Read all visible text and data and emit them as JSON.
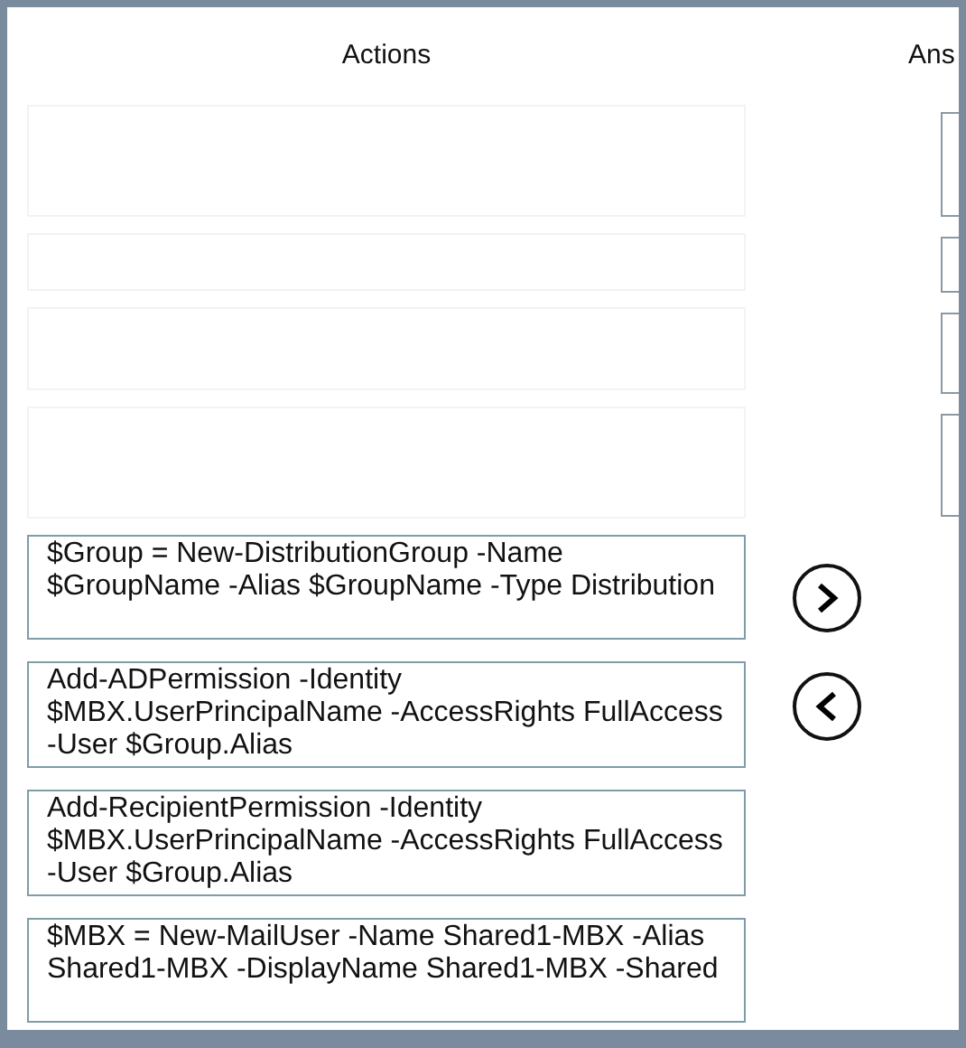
{
  "actions": {
    "header": "Actions",
    "items": [
      {
        "kind": "empty"
      },
      {
        "kind": "empty"
      },
      {
        "kind": "empty"
      },
      {
        "kind": "empty"
      },
      {
        "kind": "command",
        "text": "$Group = New-DistributionGroup -Name $GroupName -Alias $GroupName -Type Distribution"
      },
      {
        "kind": "command",
        "text": "Add-ADPermission -Identity $MBX.UserPrincipalName -AccessRights FullAccess -User $Group.Alias"
      },
      {
        "kind": "command",
        "text": "Add-RecipientPermission -Identity $MBX.UserPrincipalName -AccessRights FullAccess -User $Group.Alias"
      },
      {
        "kind": "command",
        "text": "$MBX = New-MailUser -Name Shared1-MBX -Alias Shared1-MBX -DisplayName Shared1-MBX -Shared"
      }
    ]
  },
  "answer_area": {
    "header": "Ans",
    "slots": [
      {
        "kind": "empty"
      },
      {
        "kind": "empty"
      },
      {
        "kind": "empty"
      },
      {
        "kind": "empty"
      }
    ]
  }
}
